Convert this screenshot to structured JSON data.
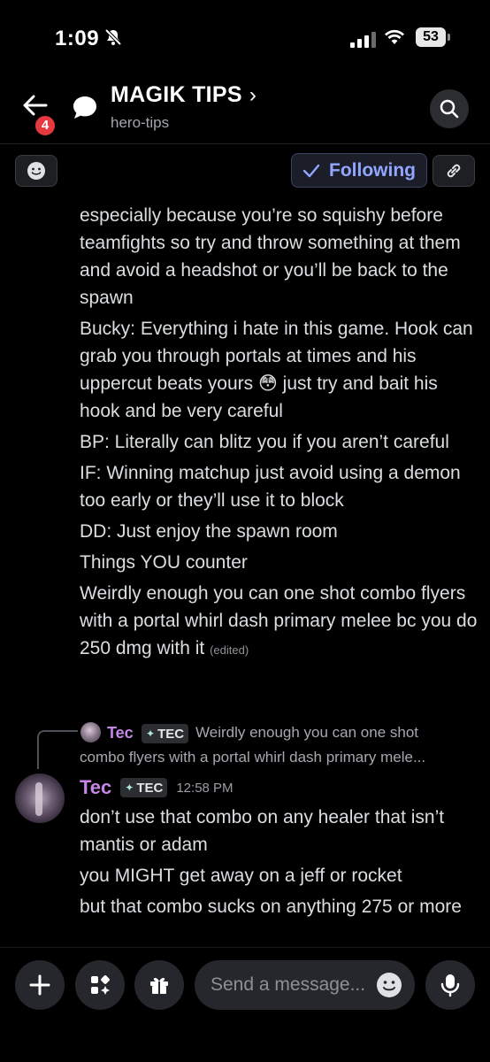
{
  "status_bar": {
    "time": "1:09",
    "battery": "53"
  },
  "header": {
    "notification_count": "4",
    "title": "MAGIK TIPS",
    "chevron": "›",
    "subtitle": "hero-tips"
  },
  "toolbar": {
    "following_label": "Following"
  },
  "messages_top": [
    "especially because you’re so squishy before teamfights so try and throw something at them and avoid a headshot or you’ll be back to the spawn",
    "Bucky: Everything i hate in this game. Hook can grab you through portals at times and his uppercut beats yours 😳 just try and bait his hook and be very careful",
    "BP: Literally can blitz you if you aren’t careful",
    "IF: Winning matchup just avoid using a demon too early or they’ll use it to block",
    "DD: Just enjoy the spawn room",
    "Things YOU counter",
    "Weirdly enough you can one shot combo flyers with a portal whirl dash primary melee bc you do 250 dmg with it"
  ],
  "edited_label": "(edited)",
  "reply": {
    "author": "Tec",
    "tag": "TEC",
    "text_line1": "Weirdly enough you can one shot",
    "text_line2": "combo flyers with a portal whirl dash primary mele..."
  },
  "message": {
    "author": "Tec",
    "tag": "TEC",
    "timestamp": "12:58 PM",
    "lines": [
      "don’t use that combo on any healer that isn’t mantis or adam",
      "you MIGHT get away on a jeff or rocket",
      "but that combo sucks on anything 275 or more"
    ]
  },
  "composer": {
    "placeholder": "Send a message..."
  },
  "colors": {
    "accent": "#93a6ff",
    "username": "#c586e8",
    "badge": "#e5383f"
  }
}
